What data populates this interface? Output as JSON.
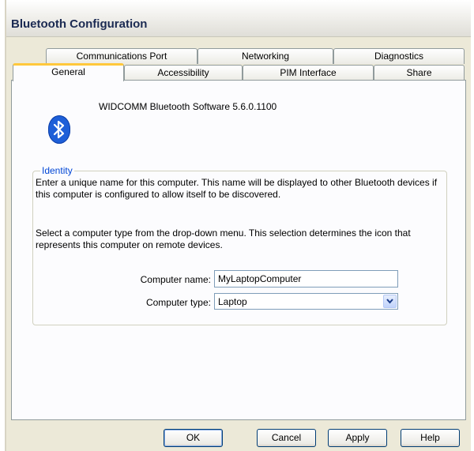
{
  "window": {
    "title": "Bluetooth Configuration"
  },
  "tabs": {
    "row_back": [
      "Communications Port",
      "Networking",
      "Diagnostics"
    ],
    "row_front": [
      "General",
      "Accessibility",
      "PIM Interface",
      "Share"
    ],
    "active": "General"
  },
  "general": {
    "version": "WIDCOMM Bluetooth Software 5.6.0.1100",
    "icon": "bluetooth-icon",
    "identity": {
      "label": "Identity",
      "paragraph1": "Enter a unique name for this computer.  This name will be displayed to other Bluetooth devices if this computer is configured to allow itself to be discovered.",
      "paragraph2": "Select a computer type from the drop-down menu.  This selection determines the icon that represents this computer on remote devices.",
      "computer_name_label": "Computer name:",
      "computer_name_value": "MyLaptopComputer",
      "computer_type_label": "Computer type:",
      "computer_type_value": "Laptop"
    }
  },
  "buttons": {
    "ok": "OK",
    "cancel": "Cancel",
    "apply": "Apply",
    "help": "Help"
  },
  "colors": {
    "accent_tab": "#ffc83c",
    "group_label": "#0046d5",
    "bluetooth_blue": "#1e5fd8"
  }
}
